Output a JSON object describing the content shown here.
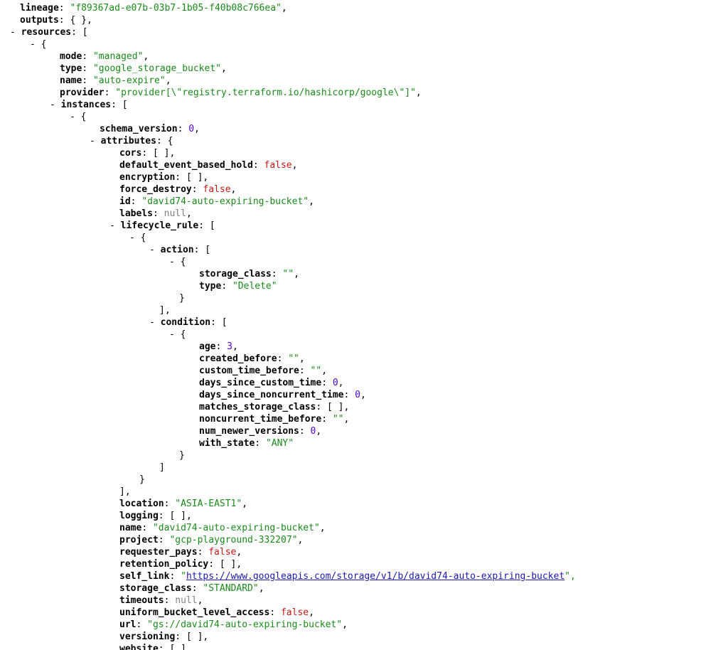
{
  "viewer": {
    "lines": [
      {
        "i": 0,
        "k": "lineage",
        "v": "\"f89367ad-e07b-03b7-1b05-f40b08c766ea\"",
        "t": "str",
        "e": ","
      },
      {
        "i": 0,
        "k": "outputs",
        "v": "{ }",
        "t": "punct",
        "e": ","
      },
      {
        "i": 0,
        "tg": true,
        "k": "resources",
        "o": "["
      },
      {
        "i": 1,
        "tg": true,
        "o": "{"
      },
      {
        "i": 2,
        "k": "mode",
        "v": "\"managed\"",
        "t": "str",
        "e": ","
      },
      {
        "i": 2,
        "k": "type",
        "v": "\"google_storage_bucket\"",
        "t": "str",
        "e": ","
      },
      {
        "i": 2,
        "k": "name",
        "v": "\"auto-expire\"",
        "t": "str",
        "e": ","
      },
      {
        "i": 2,
        "k": "provider",
        "v": "\"provider[\\\"registry.terraform.io/hashicorp/google\\\"]\"",
        "t": "str",
        "e": ","
      },
      {
        "i": 2,
        "tg": true,
        "k": "instances",
        "o": "["
      },
      {
        "i": 3,
        "tg": true,
        "o": "{"
      },
      {
        "i": 4,
        "k": "schema_version",
        "v": "0",
        "t": "num",
        "e": ","
      },
      {
        "i": 4,
        "tg": true,
        "k": "attributes",
        "o": "{"
      },
      {
        "i": 5,
        "k": "cors",
        "v": "[ ]",
        "t": "punct",
        "e": ","
      },
      {
        "i": 5,
        "k": "default_event_based_hold",
        "v": "false",
        "t": "bool",
        "e": ","
      },
      {
        "i": 5,
        "k": "encryption",
        "v": "[ ]",
        "t": "punct",
        "e": ","
      },
      {
        "i": 5,
        "k": "force_destroy",
        "v": "false",
        "t": "bool",
        "e": ","
      },
      {
        "i": 5,
        "k": "id",
        "v": "\"david74-auto-expiring-bucket\"",
        "t": "str",
        "e": ","
      },
      {
        "i": 5,
        "k": "labels",
        "v": "null",
        "t": "nul",
        "e": ","
      },
      {
        "i": 5,
        "tg": true,
        "k": "lifecycle_rule",
        "o": "["
      },
      {
        "i": 6,
        "tg": true,
        "o": "{"
      },
      {
        "i": 7,
        "tg": true,
        "k": "action",
        "o": "["
      },
      {
        "i": 8,
        "tg": true,
        "o": "{"
      },
      {
        "i": 9,
        "k": "storage_class",
        "v": "\"\"",
        "t": "str",
        "e": ","
      },
      {
        "i": 9,
        "k": "type",
        "v": "\"Delete\"",
        "t": "str",
        "e": ""
      },
      {
        "i": 8,
        "c": "}"
      },
      {
        "i": 7,
        "c": "],"
      },
      {
        "i": 7,
        "tg": true,
        "k": "condition",
        "o": "["
      },
      {
        "i": 8,
        "tg": true,
        "o": "{"
      },
      {
        "i": 9,
        "k": "age",
        "v": "3",
        "t": "num",
        "e": ","
      },
      {
        "i": 9,
        "k": "created_before",
        "v": "\"\"",
        "t": "str",
        "e": ","
      },
      {
        "i": 9,
        "k": "custom_time_before",
        "v": "\"\"",
        "t": "str",
        "e": ","
      },
      {
        "i": 9,
        "k": "days_since_custom_time",
        "v": "0",
        "t": "num",
        "e": ","
      },
      {
        "i": 9,
        "k": "days_since_noncurrent_time",
        "v": "0",
        "t": "num",
        "e": ","
      },
      {
        "i": 9,
        "k": "matches_storage_class",
        "v": "[ ]",
        "t": "punct",
        "e": ","
      },
      {
        "i": 9,
        "k": "noncurrent_time_before",
        "v": "\"\"",
        "t": "str",
        "e": ","
      },
      {
        "i": 9,
        "k": "num_newer_versions",
        "v": "0",
        "t": "num",
        "e": ","
      },
      {
        "i": 9,
        "k": "with_state",
        "v": "\"ANY\"",
        "t": "str",
        "e": ""
      },
      {
        "i": 8,
        "c": "}"
      },
      {
        "i": 7,
        "c": "]"
      },
      {
        "i": 6,
        "c": "}"
      },
      {
        "i": 5,
        "c": "],"
      },
      {
        "i": 5,
        "k": "location",
        "v": "\"ASIA-EAST1\"",
        "t": "str",
        "e": ","
      },
      {
        "i": 5,
        "k": "logging",
        "v": "[ ]",
        "t": "punct",
        "e": ","
      },
      {
        "i": 5,
        "k": "name",
        "v": "\"david74-auto-expiring-bucket\"",
        "t": "str",
        "e": ","
      },
      {
        "i": 5,
        "k": "project",
        "v": "\"gcp-playground-332207\"",
        "t": "str",
        "e": ","
      },
      {
        "i": 5,
        "k": "requester_pays",
        "v": "false",
        "t": "bool",
        "e": ","
      },
      {
        "i": 5,
        "k": "retention_policy",
        "v": "[ ]",
        "t": "punct",
        "e": ","
      },
      {
        "i": 5,
        "k": "self_link",
        "q": "\"",
        "link": "https://www.googleapis.com/storage/v1/b/david74-auto-expiring-bucket",
        "e": "\","
      },
      {
        "i": 5,
        "k": "storage_class",
        "v": "\"STANDARD\"",
        "t": "str",
        "e": ","
      },
      {
        "i": 5,
        "k": "timeouts",
        "v": "null",
        "t": "nul",
        "e": ","
      },
      {
        "i": 5,
        "k": "uniform_bucket_level_access",
        "v": "false",
        "t": "bool",
        "e": ","
      },
      {
        "i": 5,
        "k": "url",
        "v": "\"gs://david74-auto-expiring-bucket\"",
        "t": "str",
        "e": ","
      },
      {
        "i": 5,
        "k": "versioning",
        "v": "[ ]",
        "t": "punct",
        "e": ","
      },
      {
        "i": 5,
        "k": "website",
        "v": "[ ]",
        "t": "punct",
        "e": ""
      },
      {
        "i": 4,
        "c": "}"
      }
    ]
  },
  "toggle_glyph": "-",
  "colors": {
    "string": "#1a8a1a",
    "number": "#4b00d6",
    "boolean": "#c41a16",
    "null": "#808080",
    "link": "#1a1aa6"
  }
}
